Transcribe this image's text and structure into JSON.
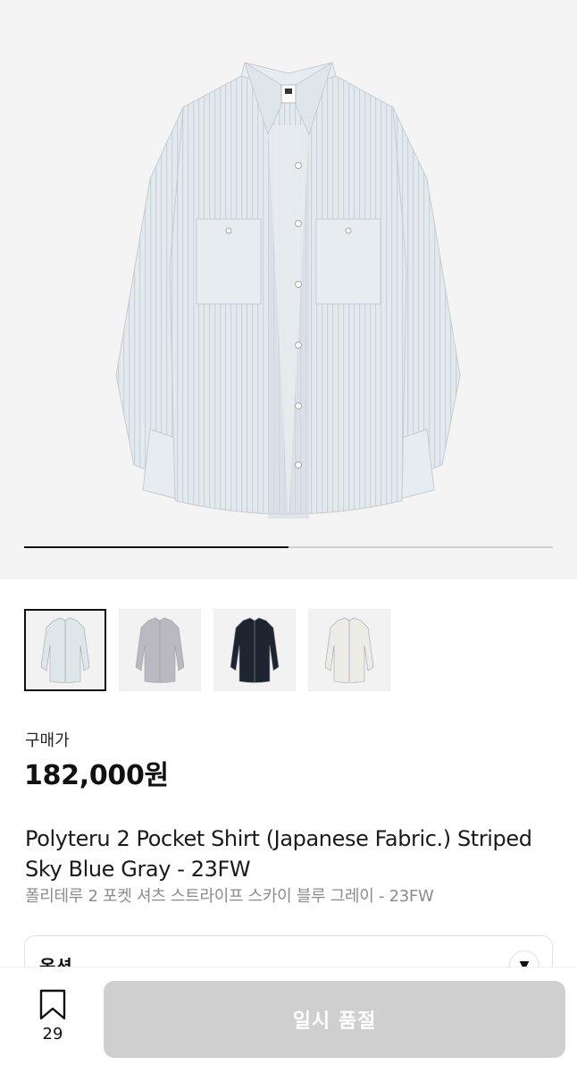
{
  "gallery": {
    "current_index": 1,
    "total": 2,
    "progress_fraction": 0.5,
    "thumbnails": [
      {
        "name": "thumb-sky-blue-stripe",
        "shirt_color": "#dfe6ea",
        "active": true
      },
      {
        "name": "thumb-gray",
        "shirt_color": "#b9b9bf",
        "active": false
      },
      {
        "name": "thumb-navy",
        "shirt_color": "#1e2430",
        "active": false
      },
      {
        "name": "thumb-ivory",
        "shirt_color": "#ecebe6",
        "active": false
      }
    ]
  },
  "price": {
    "label": "구매가",
    "value": "182,000원"
  },
  "product": {
    "title_en": "Polyteru 2 Pocket Shirt (Japanese Fabric.) Striped Sky Blue Gray - 23FW",
    "title_ko": "폴리테루 2 포켓 셔츠 스트라이프 스카이 블루 그레이 - 23FW"
  },
  "options": {
    "label": "옵션",
    "chevron": "▼"
  },
  "bottom_bar": {
    "wish_count": "29",
    "button_label": "일시 품절"
  },
  "colors": {
    "accent": "#111111",
    "disabled_button": "#cfcfcf",
    "muted_text": "#8c8c8c"
  }
}
